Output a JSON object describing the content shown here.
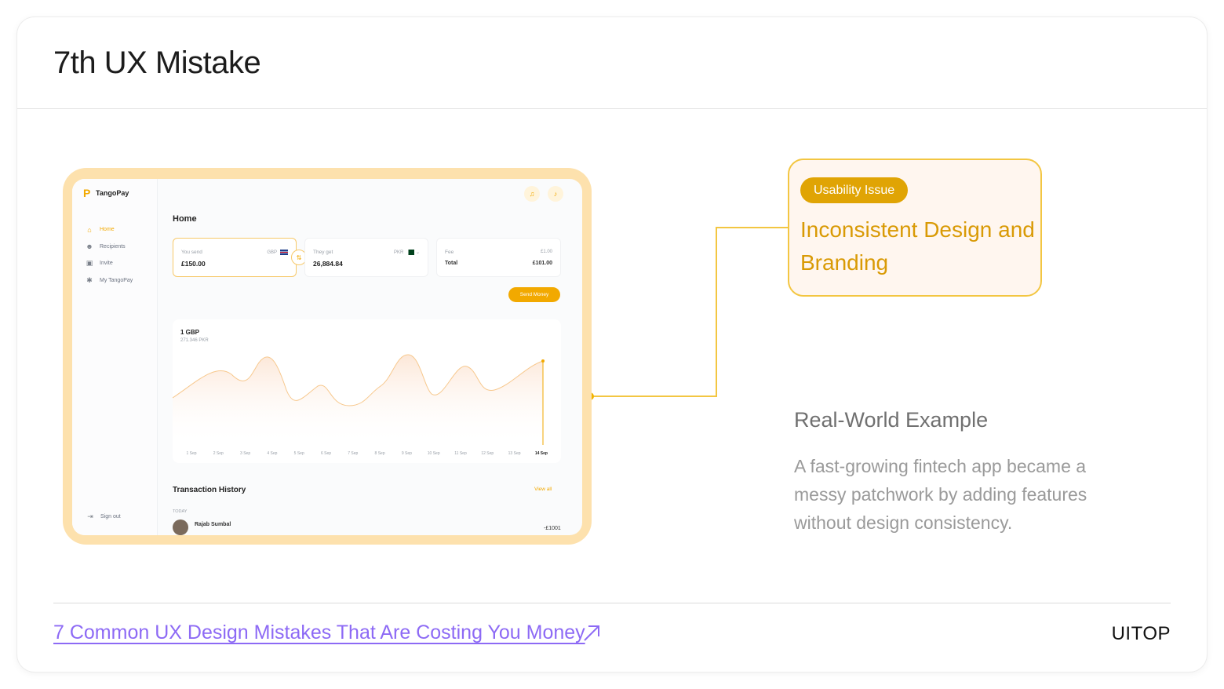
{
  "page": {
    "title": "7th UX Mistake"
  },
  "mockup": {
    "logo_text": "TangoPay",
    "nav": [
      {
        "label": "Home",
        "icon": "home-icon"
      },
      {
        "label": "Recipients",
        "icon": "users-icon"
      },
      {
        "label": "Invite",
        "icon": "gift-icon"
      },
      {
        "label": "My TangoPay",
        "icon": "gear-icon"
      }
    ],
    "sign_out": "Sign out",
    "home_title": "Home",
    "you_send": {
      "label": "You send",
      "currency": "GBP",
      "value": "£150.00"
    },
    "they_get": {
      "label": "They get",
      "currency": "PKR",
      "value": "26,884.84"
    },
    "fee": {
      "label": "Fee",
      "fee_value": "£1.00",
      "total_label": "Total",
      "total_value": "£101.00"
    },
    "send_money": "Send Money",
    "chart_header": "1 GBP",
    "chart_sub": "271.346 PKR",
    "chart_days": [
      "1 Sep",
      "2 Sep",
      "3 Sep",
      "4 Sep",
      "5 Sep",
      "6 Sep",
      "7 Sep",
      "8 Sep",
      "9 Sep",
      "10 Sep",
      "11 Sep",
      "12 Sep",
      "13 Sep",
      "14 Sep"
    ],
    "transactions_title": "Transaction History",
    "view_all": "View all",
    "today": "TODAY",
    "tx_name": "Rajab Sumbal",
    "tx_amount": "-£1001",
    "accent_color": "#f2a900"
  },
  "callout": {
    "badge": "Usability Issue",
    "title": "Inconsistent Design and Branding"
  },
  "example": {
    "title": "Real-World Example",
    "body": "A fast-growing fintech app became a messy patchwork by adding features without design consistency."
  },
  "footer": {
    "link": "7 Common UX Design Mistakes That Are Costing You Money",
    "brand": "UITOP"
  }
}
